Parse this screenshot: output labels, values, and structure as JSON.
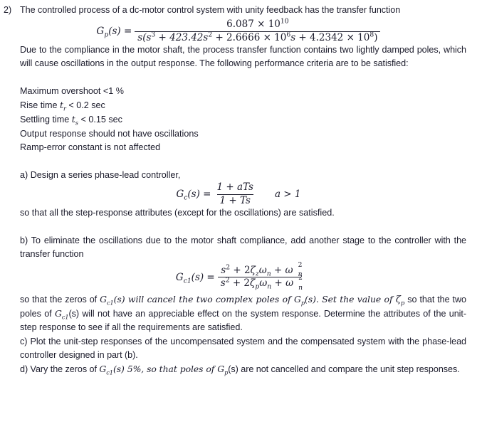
{
  "document": {
    "question_number": "2)",
    "intro": {
      "text": "The controlled process of a dc-motor control system with unity feedback has the transfer function"
    },
    "equation_gp": {
      "lhs": "G",
      "lhs_sub": "p",
      "lhs_arg": "(s) =",
      "numerator": "6.087 × 10",
      "numerator_exp": "10",
      "denominator_parts": {
        "open": "s(s",
        "exp1": "3",
        "plus1": " + 423.42s",
        "exp2": "2",
        "plus2": " + 2.6666 × 10",
        "exp3": "6",
        "s_mid": "s",
        "plus3": " + 4.2342 × 10",
        "exp4": "8",
        "close": ")"
      }
    },
    "compliance_paragraph": "Due to the compliance in the motor shaft, the process transfer function contains two lightly damped poles, which will cause oscillations in the output response. The following performance criteria are to be satisfied:",
    "criteria": [
      {
        "prefix": "Maximum overshoot <1 %",
        "symbol": "",
        "suffix": ""
      },
      {
        "prefix": "Rise time ",
        "symbol": "t",
        "symbol_sub": "r",
        "suffix": " < 0.2 sec"
      },
      {
        "prefix": "Settling time ",
        "symbol": "t",
        "symbol_sub": "s",
        "suffix": " < 0.15 sec"
      },
      {
        "prefix": "Output response should not have oscillations",
        "symbol": "",
        "suffix": ""
      },
      {
        "prefix": "Ramp-error constant is not affected",
        "symbol": "",
        "suffix": ""
      }
    ],
    "part_a": {
      "intro": "a) Design a series phase-lead controller,",
      "equation": {
        "lhs": "G",
        "lhs_sub": "c",
        "lhs_arg": "(s) =",
        "numerator": "1 + aTs",
        "denominator": "1 + Ts",
        "condition": "a > 1"
      },
      "closing": "so that all the step-response attributes (except for the oscillations) are satisfied."
    },
    "part_b": {
      "intro": "b) To eliminate the oscillations due to the motor shaft compliance, add another stage to the controller with the transfer function",
      "equation": {
        "lhs": "G",
        "lhs_sub": "c1",
        "lhs_arg": "(s) =",
        "numerator_s": "s",
        "numerator_s_exp": "2",
        "numerator_mid": " + 2",
        "numerator_zeta": "ζ",
        "numerator_zeta_sub": "z",
        "numerator_omega": "ω",
        "numerator_omega_sub": "n",
        "numerator_tail": " + ",
        "numerator_omega2": "ω",
        "denominator_s": "s",
        "denominator_s_exp": "2",
        "denominator_mid": " + 2",
        "denominator_zeta": "ζ",
        "denominator_zeta_sub": "p",
        "denominator_omega": "ω",
        "denominator_omega_sub": "n",
        "denominator_tail": " + ",
        "denominator_omega2": "ω"
      },
      "closing_part1": "so that the zeros of ",
      "closing_gc1": "G",
      "closing_gc1_sub": "c1",
      "closing_part2": "(s) will cancel the two complex poles of ",
      "closing_gp": "G",
      "closing_gp_sub": "p",
      "closing_part3": "(s). Set the value of ",
      "closing_zeta": "ζ",
      "closing_zeta_sub": "p",
      "closing_part4": " so that the two poles of ",
      "closing_gc1b": "G",
      "closing_gc1b_sub": "c1",
      "closing_part5": "(s) will not have an appreciable effect on the system response. Determine the attributes of the unit-step response to see if all the requirements are satisfied."
    },
    "part_c": {
      "text": "c) Plot the unit-step responses of the uncompensated system and the compensated system with the phase-lead controller designed in part (b)."
    },
    "part_d": {
      "part1": "d) Vary the zeros of ",
      "gc1": "G",
      "gc1_sub": "c1",
      "part2": "(s) 5%, so that poles of ",
      "gp": "G",
      "gp_sub": "p",
      "part3": "(s) are not cancelled and compare the unit step responses."
    }
  },
  "colors": {
    "text": "#1b1b2b",
    "background": "#ffffff",
    "rule": "#1b1b2b"
  }
}
